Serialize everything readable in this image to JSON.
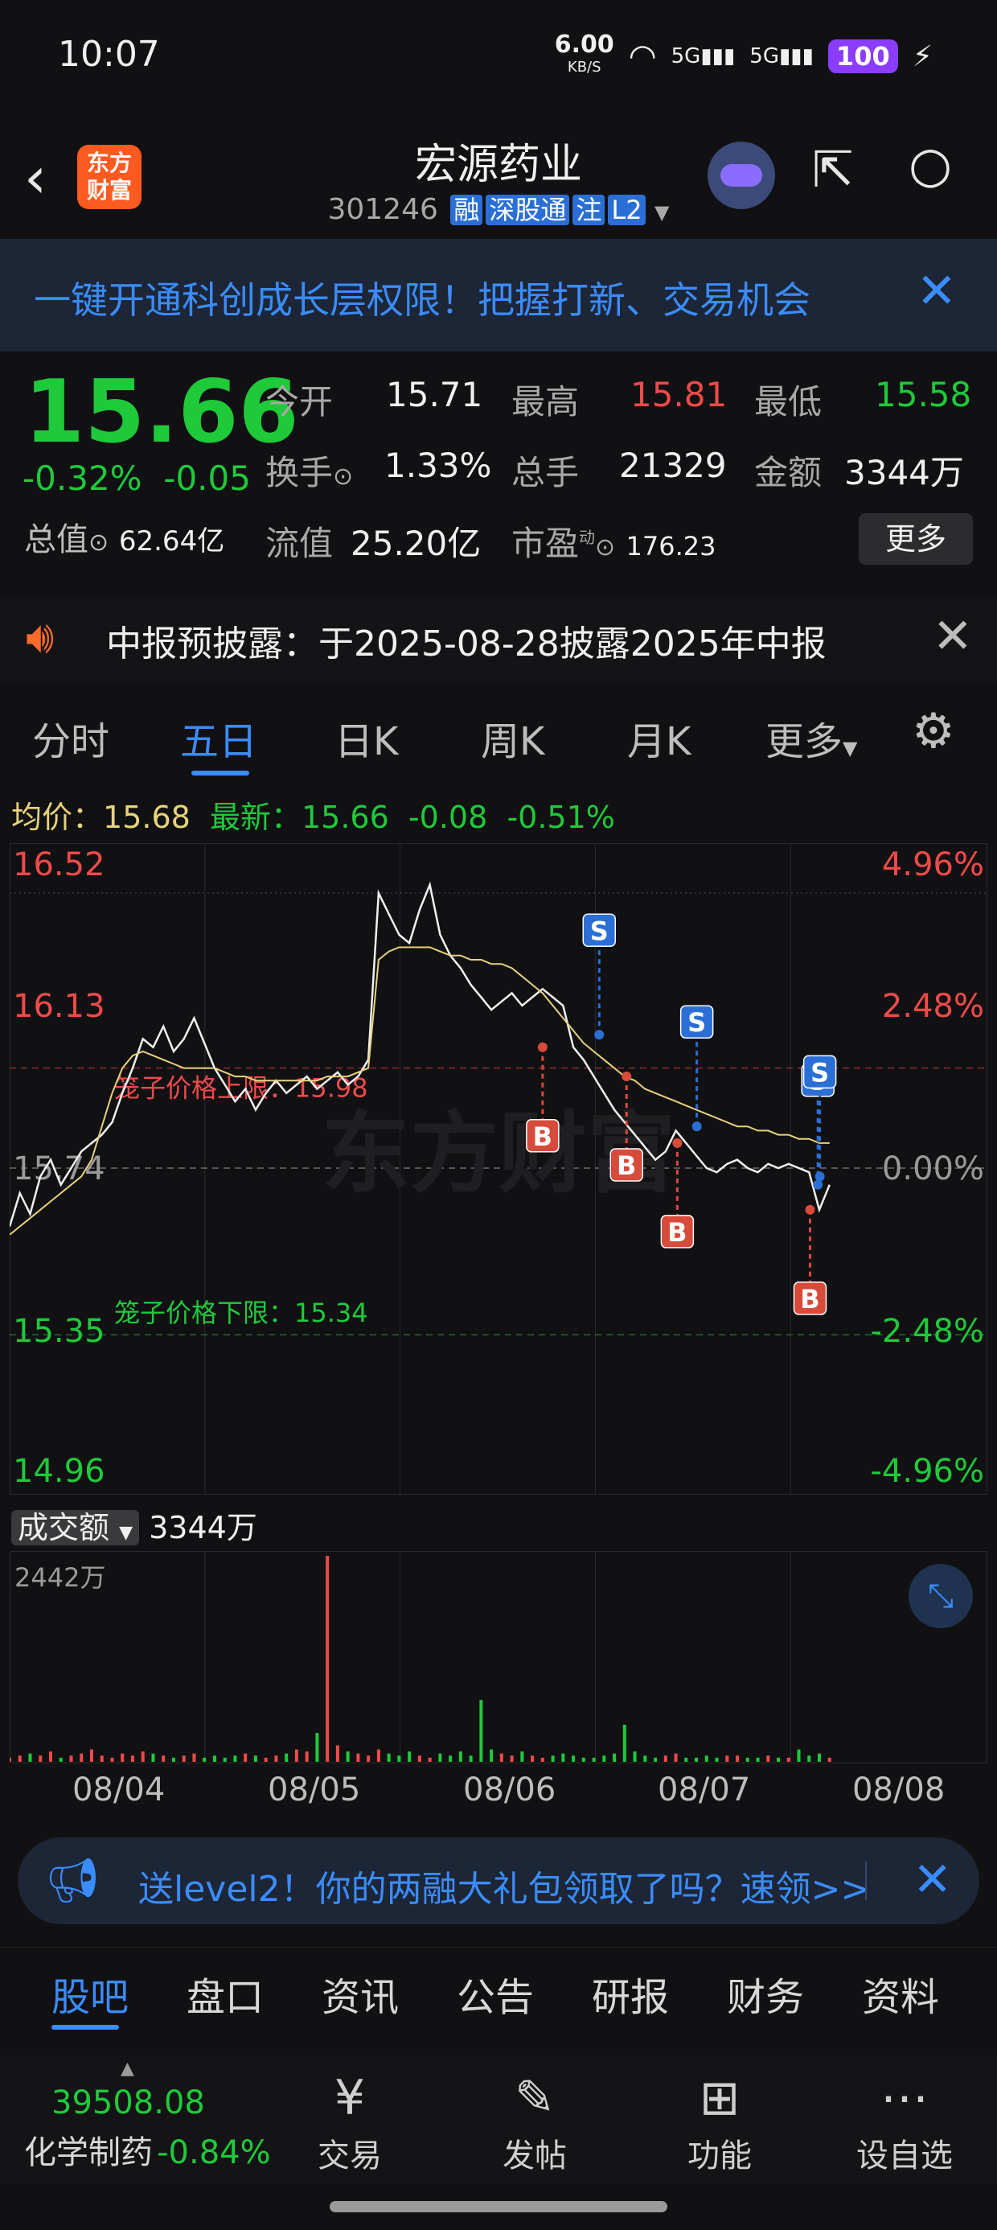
{
  "status": {
    "time": "10:07",
    "net_speed": "6.00",
    "net_unit": "KB/S",
    "signal1": "5G",
    "signal2": "5G",
    "battery": "100"
  },
  "header": {
    "title": "宏源药业",
    "code": "301246",
    "tags": [
      "融",
      "深股通",
      "注",
      "L2"
    ],
    "logo_text": "东方财富"
  },
  "banner": {
    "text": "一键开通科创成长层权限！把握打新、交易机会"
  },
  "quote": {
    "price": "15.66",
    "change_pct": "-0.32%",
    "change": "-0.05",
    "open_label": "今开",
    "open": "15.71",
    "high_label": "最高",
    "high": "15.81",
    "low_label": "最低",
    "low": "15.58",
    "turnover_label": "换手",
    "turnover": "1.33%",
    "volume_label": "总手",
    "volume": "21329",
    "amount_label": "金额",
    "amount": "3344万",
    "mktcap_label": "总值",
    "mktcap": "62.64亿",
    "float_label": "流值",
    "float": "25.20亿",
    "pe_label": "市盈",
    "pe_sup": "动",
    "pe": "176.23",
    "more": "更多"
  },
  "notice": {
    "text": "中报预披露：于2025-08-28披露2025年中报"
  },
  "tabs": [
    "分时",
    "五日",
    "日K",
    "周K",
    "月K",
    "更多"
  ],
  "avg_line": {
    "avg_label": "均价：",
    "avg": "15.68",
    "latest_label": "最新：",
    "latest": "15.66",
    "change": "-0.08",
    "change_pct": "-0.51%"
  },
  "chart_data": {
    "type": "line",
    "title": "",
    "x_labels": [
      "08/04",
      "08/05",
      "08/06",
      "08/07",
      "08/08"
    ],
    "y_left_ticks": [
      "16.52",
      "16.13",
      "15.74",
      "15.35",
      "14.96"
    ],
    "y_right_ticks": [
      "4.96%",
      "2.48%",
      "0.00%",
      "-2.48%",
      "-4.96%"
    ],
    "ylim": [
      14.96,
      16.52
    ],
    "prev_close": 15.74,
    "upper_limit_label": "笼子价格上限：15.98",
    "upper_limit": 15.98,
    "lower_limit_label": "笼子价格下限：15.34",
    "lower_limit": 15.34,
    "watermark": "东方财富",
    "series": [
      {
        "name": "价格",
        "color": "#f0f0f0",
        "values": [
          15.6,
          15.68,
          15.63,
          15.72,
          15.76,
          15.7,
          15.74,
          15.78,
          15.8,
          15.82,
          15.85,
          15.92,
          15.98,
          16.05,
          16.03,
          16.08,
          16.02,
          16.05,
          16.1,
          16.04,
          15.98,
          15.94,
          15.9,
          15.93,
          15.88,
          15.92,
          15.95,
          15.92,
          15.94,
          15.96,
          15.93,
          15.95,
          15.97,
          15.94,
          15.96,
          16.0,
          16.4,
          16.35,
          16.3,
          16.28,
          16.36,
          16.42,
          16.3,
          16.25,
          16.22,
          16.18,
          16.15,
          16.12,
          16.14,
          16.16,
          16.13,
          16.15,
          16.17,
          16.15,
          16.13,
          16.03,
          16.0,
          15.96,
          15.92,
          15.88,
          15.85,
          15.82,
          15.79,
          15.76,
          15.78,
          15.83,
          15.8,
          15.77,
          15.74,
          15.73,
          15.75,
          15.76,
          15.74,
          15.73,
          15.75,
          15.74,
          15.75,
          15.74,
          15.73,
          15.64,
          15.7
        ]
      },
      {
        "name": "均价",
        "color": "#e8d27a",
        "values": [
          15.58,
          15.6,
          15.62,
          15.64,
          15.66,
          15.68,
          15.7,
          15.72,
          15.76,
          15.84,
          15.92,
          15.98,
          16.01,
          16.02,
          16.01,
          16.0,
          15.99,
          15.98,
          15.98,
          15.98,
          15.98,
          15.97,
          15.96,
          15.96,
          15.95,
          15.95,
          15.95,
          15.95,
          15.95,
          15.95,
          15.95,
          15.96,
          15.96,
          15.96,
          15.97,
          15.98,
          16.24,
          16.26,
          16.27,
          16.27,
          16.27,
          16.27,
          16.26,
          16.25,
          16.25,
          16.24,
          16.24,
          16.23,
          16.23,
          16.22,
          16.2,
          16.18,
          16.16,
          16.13,
          16.1,
          16.07,
          16.04,
          16.02,
          16.0,
          15.98,
          15.96,
          15.95,
          15.93,
          15.92,
          15.91,
          15.9,
          15.89,
          15.88,
          15.87,
          15.86,
          15.85,
          15.84,
          15.84,
          15.83,
          15.83,
          15.82,
          15.82,
          15.81,
          15.81,
          15.8,
          15.8
        ]
      }
    ],
    "trade_markers": [
      {
        "side": "B",
        "price": 16.03,
        "day": 2.73
      },
      {
        "side": "S",
        "price": 16.06,
        "day": 3.02
      },
      {
        "side": "B",
        "price": 15.96,
        "day": 3.16
      },
      {
        "side": "B",
        "price": 15.8,
        "day": 3.42
      },
      {
        "side": "S",
        "price": 15.84,
        "day": 3.52
      },
      {
        "side": "B",
        "price": 15.64,
        "day": 4.1
      },
      {
        "side": "S",
        "price": 15.7,
        "day": 4.14
      },
      {
        "side": "S",
        "price": 15.72,
        "day": 4.15
      }
    ],
    "volume": {
      "label": "成交额",
      "total": "3344万",
      "max_label": "2442万",
      "values": [
        2,
        3,
        4,
        3,
        5,
        2,
        3,
        4,
        6,
        3,
        2,
        4,
        3,
        5,
        4,
        3,
        2,
        3,
        4,
        2,
        3,
        2,
        3,
        4,
        3,
        2,
        3,
        4,
        6,
        5,
        14,
        100,
        8,
        5,
        4,
        3,
        6,
        4,
        3,
        5,
        3,
        2,
        4,
        3,
        5,
        3,
        30,
        6,
        4,
        3,
        5,
        3,
        2,
        3,
        4,
        3,
        2,
        2,
        3,
        4,
        18,
        5,
        3,
        2,
        3,
        4,
        2,
        2,
        3,
        2,
        3,
        3,
        2,
        2,
        3,
        2,
        2,
        6,
        3,
        4,
        2
      ]
    }
  },
  "promo": {
    "text": "送level2！你的两融大礼包领取了吗？速领>>"
  },
  "bottom_tabs": [
    "股吧",
    "盘口",
    "资讯",
    "公告",
    "研报",
    "财务",
    "资料"
  ],
  "index": {
    "value": "39508.08",
    "name": "化学制药",
    "change": "-0.84%"
  },
  "nav": [
    {
      "icon": "trade-icon",
      "label": "交易"
    },
    {
      "icon": "post-icon",
      "label": "发帖"
    },
    {
      "icon": "function-icon",
      "label": "功能"
    },
    {
      "icon": "watchlist-icon",
      "label": "设自选"
    }
  ],
  "colors": {
    "up": "#f24a4a",
    "down": "#1fca3a",
    "accent": "#3b8cff",
    "avg": "#e8d27a",
    "buy": "#d84a3a",
    "sell": "#2b6fd6"
  }
}
